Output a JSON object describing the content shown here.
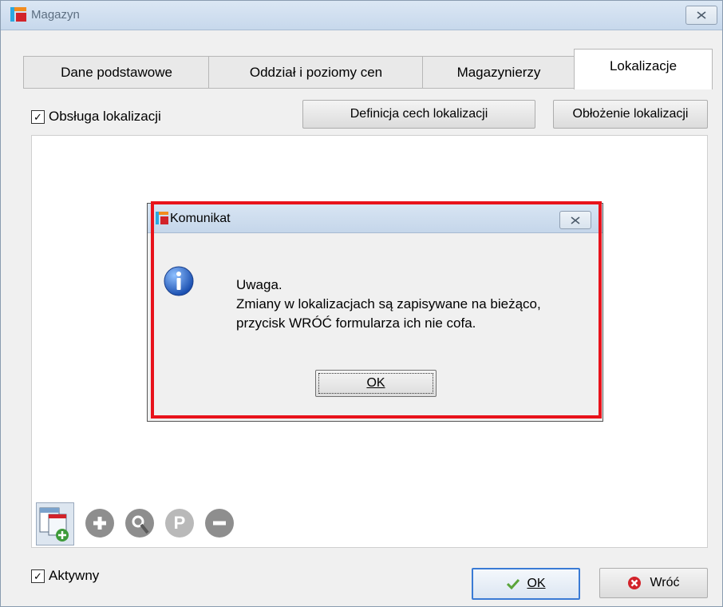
{
  "window": {
    "title": "Magazyn"
  },
  "tabs": [
    {
      "label": "Dane podstawowe",
      "active": false
    },
    {
      "label": "Oddział i poziomy cen",
      "active": false
    },
    {
      "label": "Magazynierzy",
      "active": false
    },
    {
      "label": "Lokalizacje",
      "active": true
    }
  ],
  "lokalizacje": {
    "obsluga_label": "Obsługa lokalizacji",
    "obsluga_checked": true,
    "definicja_button": "Definicja cech lokalizacji",
    "obłożenie_button": "Obłożenie lokalizacji",
    "toolbar_icons": [
      "add-location-icon",
      "plus-circle-icon",
      "search-circle-icon",
      "p-circle-icon",
      "minus-circle-icon"
    ],
    "p_glyph": "P"
  },
  "footer": {
    "aktywny_label": "Aktywny",
    "aktywny_checked": true,
    "ok_label": "OK",
    "wroc_label": "Wróć"
  },
  "dialog": {
    "title": "Komunikat",
    "line1": "Uwaga.",
    "line2": "Zmiany w lokalizacjach są zapisywane na bieżąco,",
    "line3": "przycisk WRÓĆ formularza ich nie cofa.",
    "ok_label": "OK",
    "icon": "info-icon"
  },
  "colors": {
    "highlight": "#e8131b",
    "accent": "#3a7bd5"
  }
}
